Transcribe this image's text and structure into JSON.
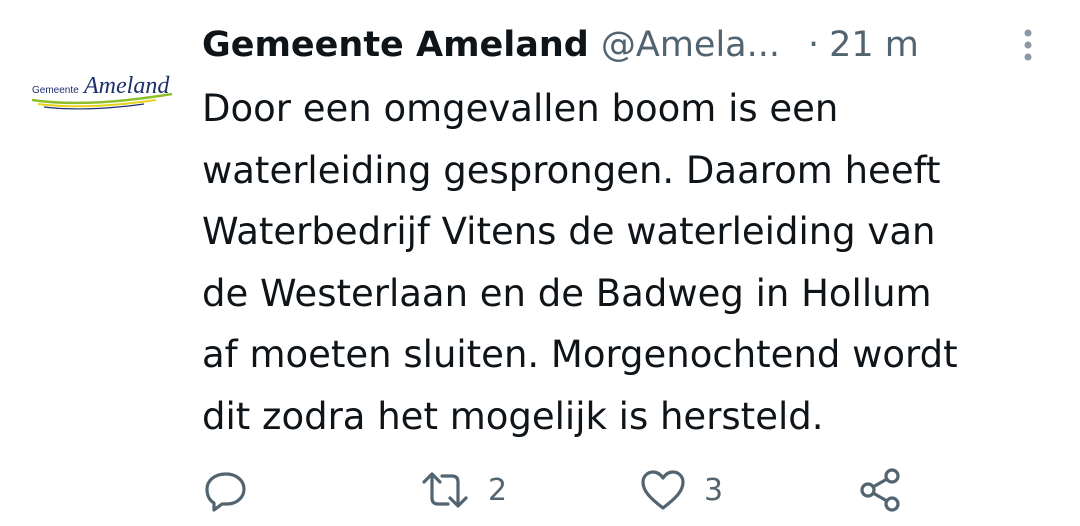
{
  "tweet": {
    "avatar": {
      "small_text": "Gemeente",
      "large_text": "Ameland"
    },
    "display_name": "Gemeente Ameland",
    "handle": "@Amela...",
    "separator": "·",
    "time": "21 m",
    "text": "Door een omgevallen boom is een\nwaterleiding gesprongen. Daarom heeft\nWaterbedrijf Vitens de waterleiding van\nde Westerlaan en de Badweg in Hollum\naf moeten sluiten. Morgenochtend wordt\ndit zodra het mogelijk is hersteld.",
    "actions": {
      "reply": {
        "icon": "reply-icon",
        "count": ""
      },
      "retweet": {
        "icon": "retweet-icon",
        "count": "2"
      },
      "like": {
        "icon": "heart-icon",
        "count": "3"
      },
      "share": {
        "icon": "share-icon"
      }
    }
  },
  "colors": {
    "text_primary": "#0f1419",
    "text_secondary": "#536471",
    "logo_navy": "#1e2f6e",
    "logo_green": "#8fbf2a",
    "logo_yellow": "#e8d21a"
  }
}
